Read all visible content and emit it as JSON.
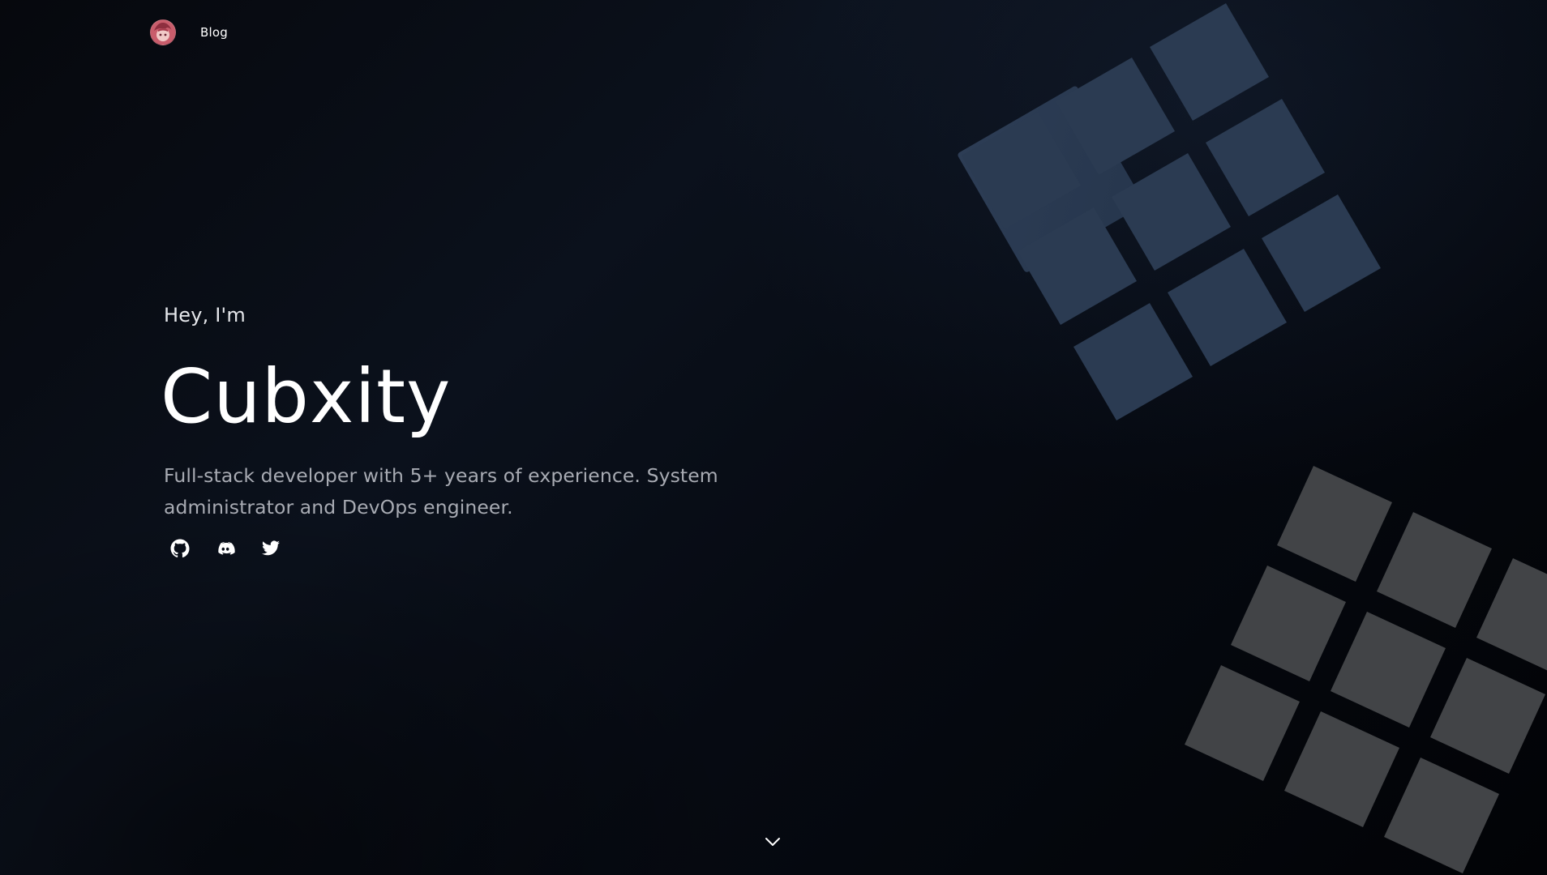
{
  "nav": {
    "avatar_alt": "profile-avatar",
    "blog_label": "Blog"
  },
  "hero": {
    "greeting": "Hey, I'm",
    "name": "Cubxity",
    "tagline": "Full-stack developer with 5+ years of experience. System administrator and DevOps engineer."
  },
  "socials": [
    {
      "icon": "github-icon"
    },
    {
      "icon": "discord-icon"
    },
    {
      "icon": "twitter-icon"
    }
  ],
  "scroll": {
    "icon": "chevron-down-icon"
  },
  "colors": {
    "background": "#080c14",
    "text": "#ffffff",
    "muted_text": "#a8abb3",
    "decor_blue": "#2a3a52",
    "decor_gray": "#434548"
  }
}
